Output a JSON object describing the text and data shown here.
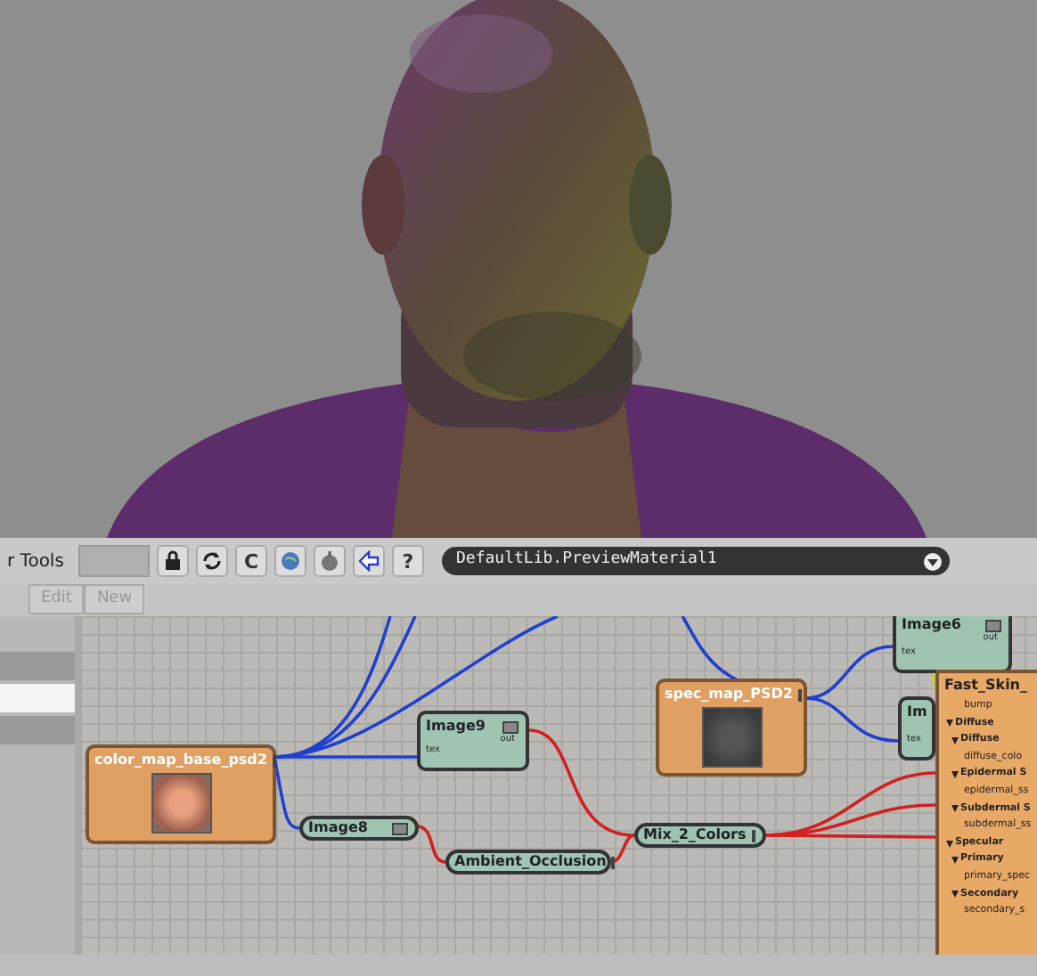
{
  "toolbar": {
    "label": "r Tools",
    "letter_buttons": [
      "C",
      "?"
    ],
    "material_dropdown": {
      "value": "DefaultLib.PreviewMaterial1"
    }
  },
  "menu": [
    {
      "label": "Edit",
      "disabled": true
    },
    {
      "label": "New",
      "disabled": true
    }
  ],
  "sidebar": {
    "items": [
      {
        "selected": false
      },
      {
        "selected": true
      },
      {
        "selected": false
      }
    ]
  },
  "nodes": [
    {
      "name": "Image6",
      "kind": "utility",
      "ports": [
        "tex",
        "out"
      ]
    },
    {
      "name": "spec_map_PSD2",
      "kind": "spec_texture"
    },
    {
      "name": "Im",
      "kind": "utility",
      "ports": [
        "tex"
      ]
    },
    {
      "name": "Image9",
      "kind": "utility",
      "ports": [
        "tex",
        "out"
      ]
    },
    {
      "name": "color_map_base_psd2",
      "kind": "color_texture"
    },
    {
      "name": "Image8",
      "kind": "pill"
    },
    {
      "name": "Mix_2_Colors",
      "kind": "pill"
    },
    {
      "name": "Ambient_Occlusion",
      "kind": "pill"
    },
    {
      "name": "Fast_Skin_",
      "kind": "shader",
      "attributes": [
        {
          "label": "bump",
          "kind": "input"
        },
        {
          "label": "Diffuse",
          "kind": "group"
        },
        {
          "label": "Diffuse",
          "kind": "subgroup"
        },
        {
          "label": "diffuse_colo",
          "kind": "input"
        },
        {
          "label": "Epidermal S",
          "kind": "subgroup"
        },
        {
          "label": "epidermal_ss",
          "kind": "input"
        },
        {
          "label": "Subdermal S",
          "kind": "subgroup"
        },
        {
          "label": "subdermal_ss",
          "kind": "input"
        },
        {
          "label": "Specular",
          "kind": "group"
        },
        {
          "label": "Primary",
          "kind": "subgroup"
        },
        {
          "label": "primary_spec",
          "kind": "input"
        },
        {
          "label": "Secondary",
          "kind": "subgroup"
        },
        {
          "label": "secondary_s",
          "kind": "input"
        }
      ]
    }
  ]
}
